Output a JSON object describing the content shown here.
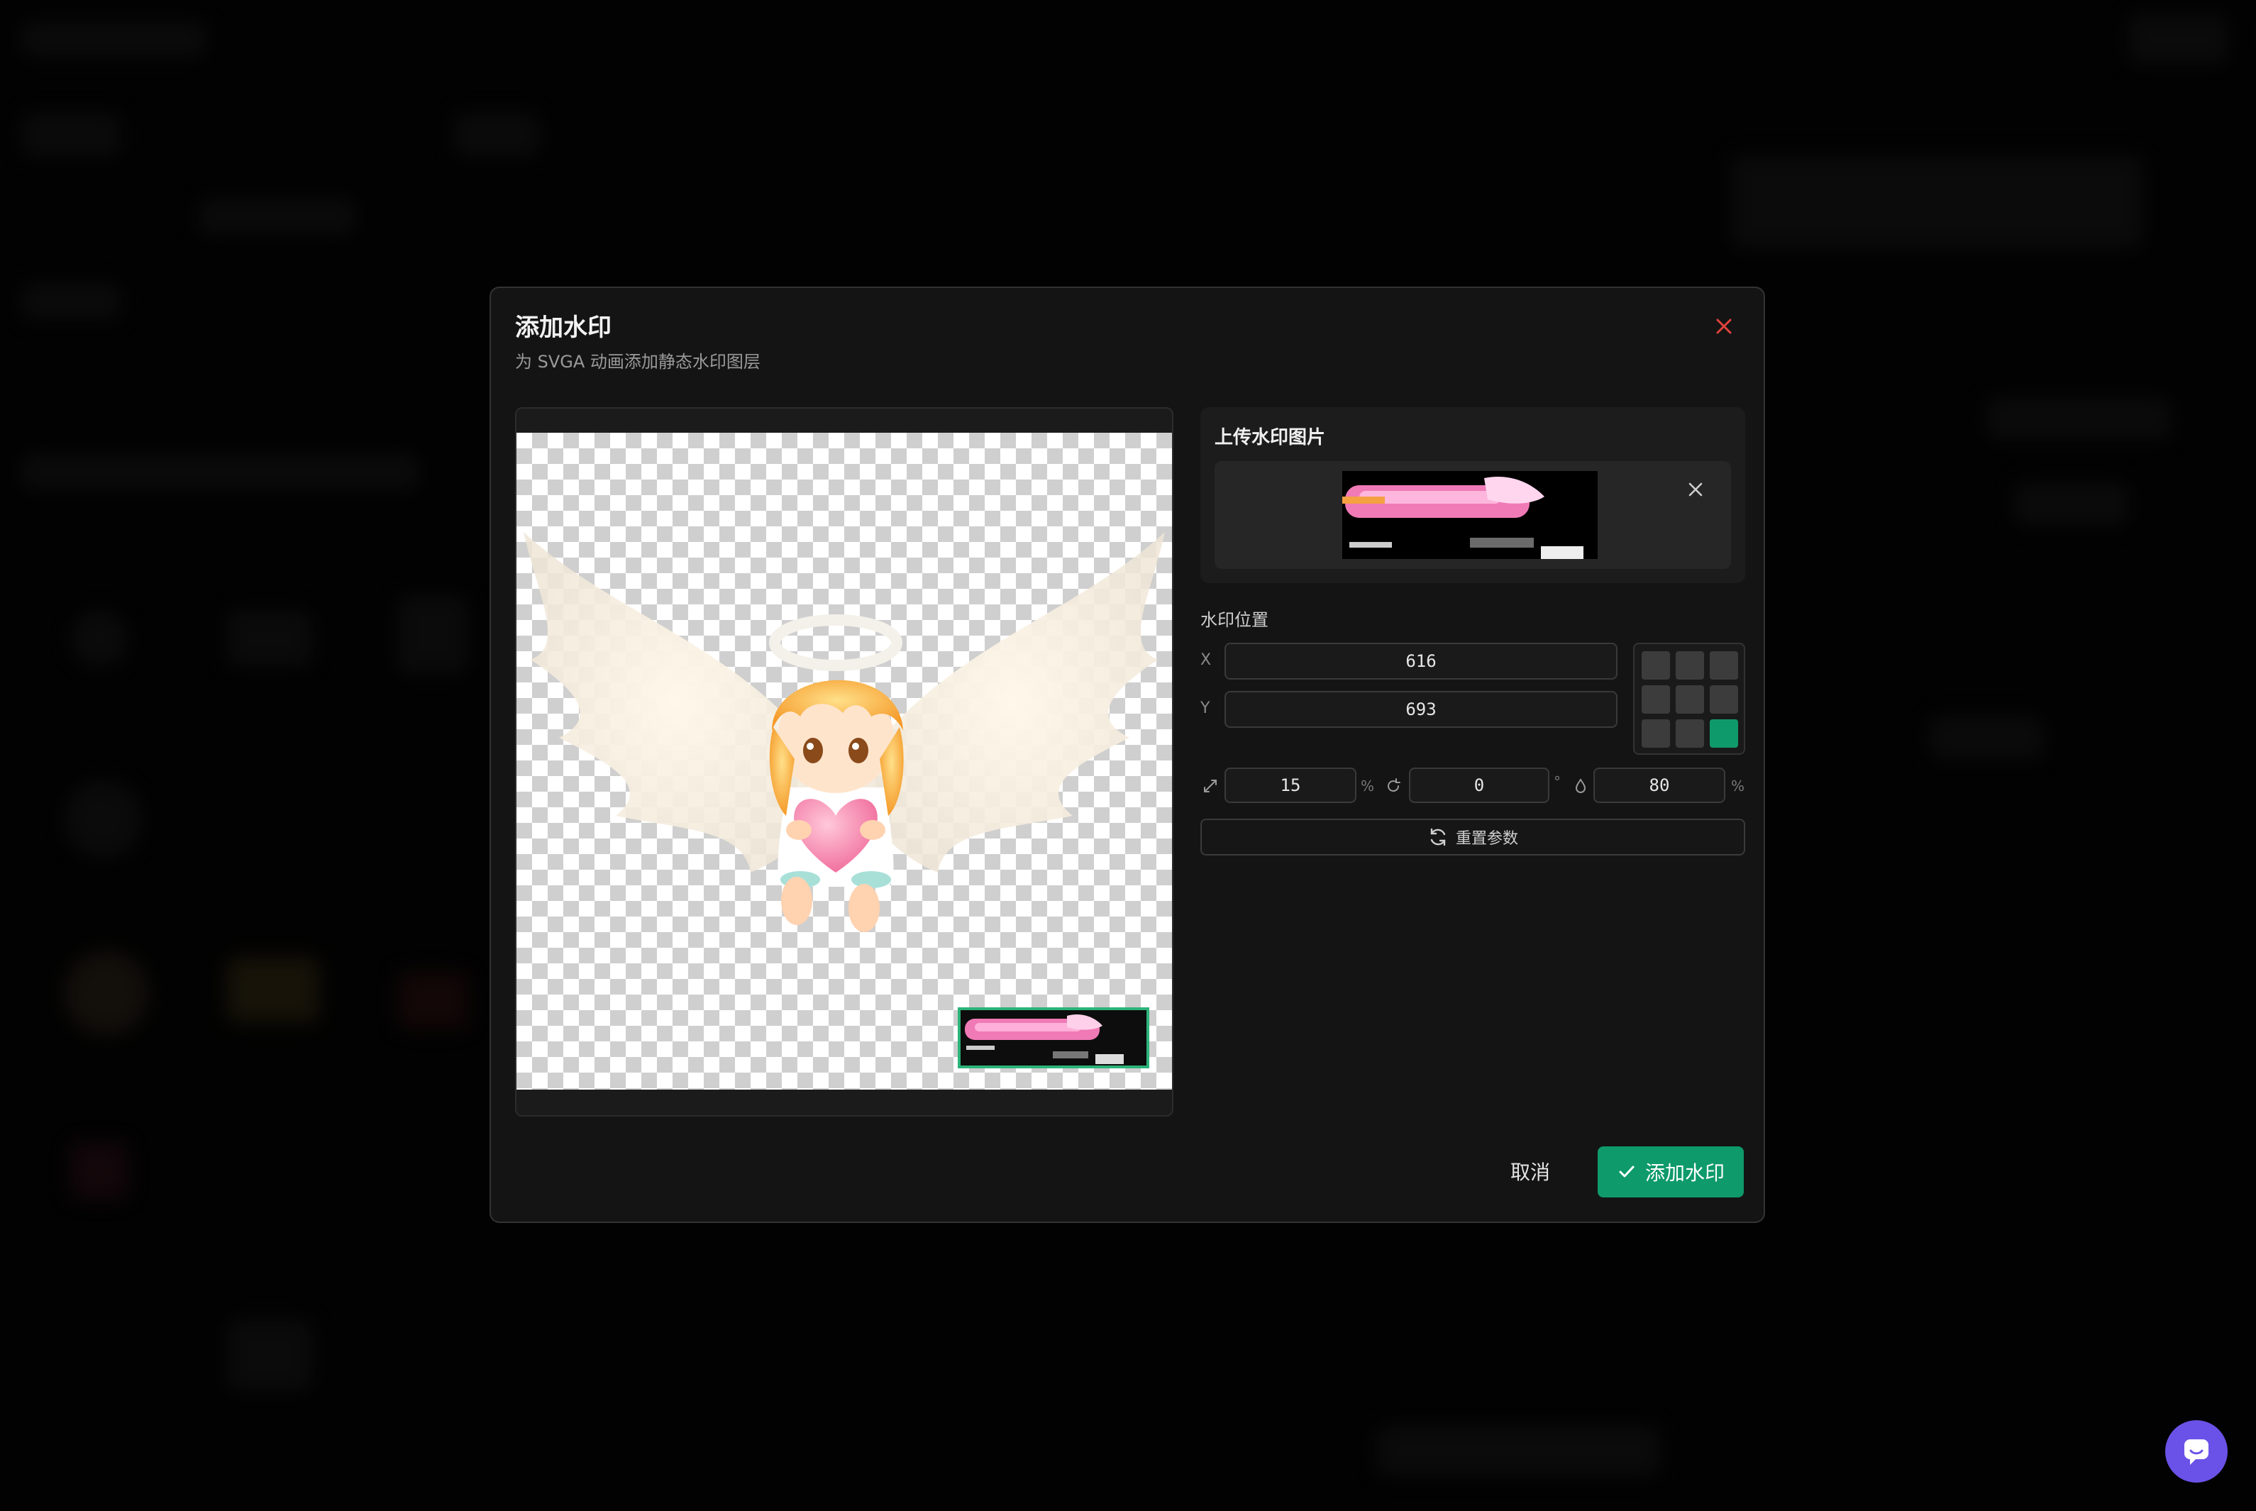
{
  "modal": {
    "title": "添加水印",
    "subtitle": "为 SVGA 动画添加静态水印图层"
  },
  "upload": {
    "title": "上传水印图片"
  },
  "position": {
    "label": "水印位置",
    "x_label": "X",
    "y_label": "Y",
    "x_value": "616",
    "y_value": "693",
    "anchor_grid": {
      "rows": 3,
      "cols": 3,
      "selected": "bottom-right"
    }
  },
  "transform": {
    "scale_value": "15",
    "scale_unit": "%",
    "rotate_value": "0",
    "rotate_unit": "°",
    "opacity_value": "80",
    "opacity_unit": "%"
  },
  "actions": {
    "reset_label": "重置参数",
    "cancel_label": "取消",
    "submit_label": "添加水印"
  },
  "colors": {
    "accent": "#0e9a6a",
    "close": "#e0433b",
    "chat": "#6a52e8"
  }
}
